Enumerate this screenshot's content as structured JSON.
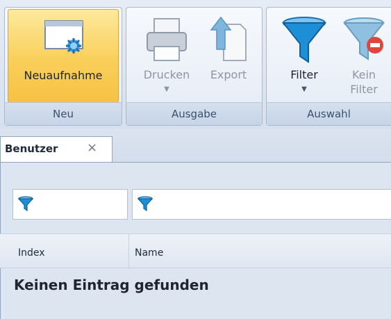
{
  "ribbon": {
    "groups": [
      {
        "label": "Neu",
        "buttons": [
          {
            "label": "Neuaufnahme",
            "icon": "new-record-icon",
            "state": "selected"
          }
        ]
      },
      {
        "label": "Ausgabe",
        "buttons": [
          {
            "label": "Drucken",
            "icon": "printer-icon",
            "state": "disabled",
            "has_dropdown": true
          },
          {
            "label": "Export",
            "icon": "export-icon",
            "state": "disabled"
          }
        ]
      },
      {
        "label": "Auswahl",
        "buttons": [
          {
            "label": "Filter",
            "icon": "funnel-icon",
            "state": "enabled",
            "has_dropdown": true
          },
          {
            "label_line1": "Kein",
            "label_line2": "Filter",
            "icon": "funnel-remove-icon",
            "state": "disabled"
          }
        ]
      }
    ]
  },
  "tabs": [
    {
      "label": "Benutzer",
      "close_glyph": "×",
      "active": true
    }
  ],
  "grid": {
    "filters": [
      {
        "icon": "funnel-icon"
      },
      {
        "icon": "funnel-icon"
      }
    ],
    "columns": [
      "Index",
      "Name"
    ],
    "empty_message": "Keinen Eintrag gefunden"
  },
  "colors": {
    "selected_button": "#f9cf5a",
    "funnel_blue": "#1d8fd6",
    "remove_red": "#e0463c"
  }
}
